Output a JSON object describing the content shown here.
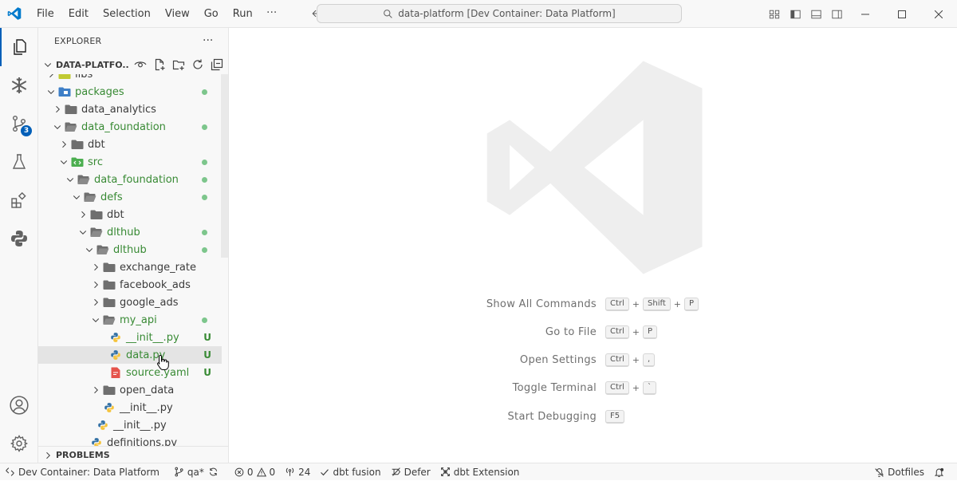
{
  "titlebar": {
    "menu": [
      "File",
      "Edit",
      "Selection",
      "View",
      "Go",
      "Run"
    ],
    "more": "···",
    "command_center": "data-platform [Dev Container: Data Platform]"
  },
  "activity_bar": {
    "source_control_badge": "3"
  },
  "sidebar": {
    "title": "EXPLORER",
    "more": "···",
    "section_title": "DATA-PLATFO...",
    "tree": [
      {
        "label": "libs",
        "type": "folder",
        "expanded": false,
        "depth": 1,
        "status": "none"
      },
      {
        "label": "packages",
        "type": "folder-special",
        "expanded": true,
        "depth": 1,
        "status": "dot"
      },
      {
        "label": "data_analytics",
        "type": "folder",
        "expanded": false,
        "depth": 2,
        "status": "none"
      },
      {
        "label": "data_foundation",
        "type": "folder",
        "expanded": true,
        "depth": 2,
        "status": "dot"
      },
      {
        "label": "dbt",
        "type": "folder",
        "expanded": false,
        "depth": 3,
        "status": "none"
      },
      {
        "label": "src",
        "type": "folder-src",
        "expanded": true,
        "depth": 3,
        "status": "dot"
      },
      {
        "label": "data_foundation",
        "type": "folder",
        "expanded": true,
        "depth": 4,
        "status": "dot"
      },
      {
        "label": "defs",
        "type": "folder",
        "expanded": true,
        "depth": 5,
        "status": "dot"
      },
      {
        "label": "dbt",
        "type": "folder",
        "expanded": false,
        "depth": 6,
        "status": "none"
      },
      {
        "label": "dlthub",
        "type": "folder",
        "expanded": true,
        "depth": 6,
        "status": "dot"
      },
      {
        "label": "dlthub",
        "type": "folder",
        "expanded": true,
        "depth": 7,
        "status": "dot"
      },
      {
        "label": "exchange_rate",
        "type": "folder",
        "expanded": false,
        "depth": 8,
        "status": "none"
      },
      {
        "label": "facebook_ads",
        "type": "folder",
        "expanded": false,
        "depth": 8,
        "status": "none"
      },
      {
        "label": "google_ads",
        "type": "folder",
        "expanded": false,
        "depth": 8,
        "status": "none"
      },
      {
        "label": "my_api",
        "type": "folder",
        "expanded": true,
        "depth": 8,
        "status": "dot"
      },
      {
        "label": "__init__.py",
        "type": "python",
        "depth": 9,
        "status": "U"
      },
      {
        "label": "data.py",
        "type": "python",
        "depth": 9,
        "status": "U",
        "selected": true
      },
      {
        "label": "source.yaml",
        "type": "yaml",
        "depth": 9,
        "status": "U"
      },
      {
        "label": "open_data",
        "type": "folder",
        "expanded": false,
        "depth": 8,
        "status": "none"
      },
      {
        "label": "__init__.py",
        "type": "python",
        "depth": 8,
        "status": "none"
      },
      {
        "label": "__init__.py",
        "type": "python",
        "depth": 7,
        "status": "none"
      },
      {
        "label": "definitions.py",
        "type": "python",
        "depth": 6,
        "status": "none"
      }
    ],
    "problems_title": "PROBLEMS"
  },
  "editor": {
    "shortcuts": [
      {
        "label": "Show All Commands",
        "keys": [
          "Ctrl",
          "Shift",
          "P"
        ]
      },
      {
        "label": "Go to File",
        "keys": [
          "Ctrl",
          "P"
        ]
      },
      {
        "label": "Open Settings",
        "keys": [
          "Ctrl",
          ","
        ]
      },
      {
        "label": "Toggle Terminal",
        "keys": [
          "Ctrl",
          "`"
        ]
      },
      {
        "label": "Start Debugging",
        "keys": [
          "F5"
        ]
      }
    ]
  },
  "statusbar": {
    "remote": "Dev Container: Data Platform",
    "branch": "qa*",
    "errors": "0",
    "warnings": "0",
    "ports": "24",
    "dbt_fusion": "dbt fusion",
    "defer": "Defer",
    "dbt_extension": "dbt Extension",
    "dotfiles": "Dotfiles"
  },
  "colors": {
    "accent": "#005fb8",
    "git_added": "#388a34",
    "git_dot": "#7dc68c",
    "yaml_icon": "#e5534b",
    "python_blue": "#3572a5",
    "python_yellow": "#f5c33b"
  }
}
